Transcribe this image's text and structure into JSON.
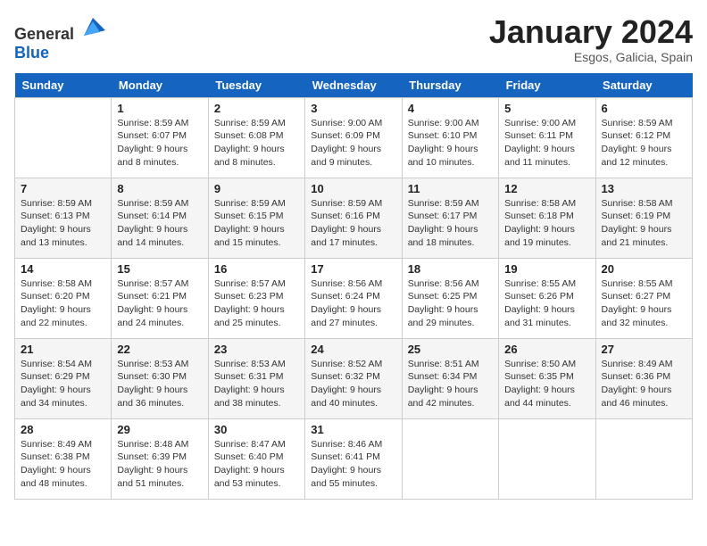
{
  "logo": {
    "text_general": "General",
    "text_blue": "Blue"
  },
  "title": "January 2024",
  "location": "Esgos, Galicia, Spain",
  "weekdays": [
    "Sunday",
    "Monday",
    "Tuesday",
    "Wednesday",
    "Thursday",
    "Friday",
    "Saturday"
  ],
  "weeks": [
    [
      {
        "day": "",
        "sunrise": "",
        "sunset": "",
        "daylight": "",
        "empty": true
      },
      {
        "day": "1",
        "sunrise": "Sunrise: 8:59 AM",
        "sunset": "Sunset: 6:07 PM",
        "daylight": "Daylight: 9 hours and 8 minutes.",
        "empty": false
      },
      {
        "day": "2",
        "sunrise": "Sunrise: 8:59 AM",
        "sunset": "Sunset: 6:08 PM",
        "daylight": "Daylight: 9 hours and 8 minutes.",
        "empty": false
      },
      {
        "day": "3",
        "sunrise": "Sunrise: 9:00 AM",
        "sunset": "Sunset: 6:09 PM",
        "daylight": "Daylight: 9 hours and 9 minutes.",
        "empty": false
      },
      {
        "day": "4",
        "sunrise": "Sunrise: 9:00 AM",
        "sunset": "Sunset: 6:10 PM",
        "daylight": "Daylight: 9 hours and 10 minutes.",
        "empty": false
      },
      {
        "day": "5",
        "sunrise": "Sunrise: 9:00 AM",
        "sunset": "Sunset: 6:11 PM",
        "daylight": "Daylight: 9 hours and 11 minutes.",
        "empty": false
      },
      {
        "day": "6",
        "sunrise": "Sunrise: 8:59 AM",
        "sunset": "Sunset: 6:12 PM",
        "daylight": "Daylight: 9 hours and 12 minutes.",
        "empty": false
      }
    ],
    [
      {
        "day": "7",
        "sunrise": "Sunrise: 8:59 AM",
        "sunset": "Sunset: 6:13 PM",
        "daylight": "Daylight: 9 hours and 13 minutes.",
        "empty": false
      },
      {
        "day": "8",
        "sunrise": "Sunrise: 8:59 AM",
        "sunset": "Sunset: 6:14 PM",
        "daylight": "Daylight: 9 hours and 14 minutes.",
        "empty": false
      },
      {
        "day": "9",
        "sunrise": "Sunrise: 8:59 AM",
        "sunset": "Sunset: 6:15 PM",
        "daylight": "Daylight: 9 hours and 15 minutes.",
        "empty": false
      },
      {
        "day": "10",
        "sunrise": "Sunrise: 8:59 AM",
        "sunset": "Sunset: 6:16 PM",
        "daylight": "Daylight: 9 hours and 17 minutes.",
        "empty": false
      },
      {
        "day": "11",
        "sunrise": "Sunrise: 8:59 AM",
        "sunset": "Sunset: 6:17 PM",
        "daylight": "Daylight: 9 hours and 18 minutes.",
        "empty": false
      },
      {
        "day": "12",
        "sunrise": "Sunrise: 8:58 AM",
        "sunset": "Sunset: 6:18 PM",
        "daylight": "Daylight: 9 hours and 19 minutes.",
        "empty": false
      },
      {
        "day": "13",
        "sunrise": "Sunrise: 8:58 AM",
        "sunset": "Sunset: 6:19 PM",
        "daylight": "Daylight: 9 hours and 21 minutes.",
        "empty": false
      }
    ],
    [
      {
        "day": "14",
        "sunrise": "Sunrise: 8:58 AM",
        "sunset": "Sunset: 6:20 PM",
        "daylight": "Daylight: 9 hours and 22 minutes.",
        "empty": false
      },
      {
        "day": "15",
        "sunrise": "Sunrise: 8:57 AM",
        "sunset": "Sunset: 6:21 PM",
        "daylight": "Daylight: 9 hours and 24 minutes.",
        "empty": false
      },
      {
        "day": "16",
        "sunrise": "Sunrise: 8:57 AM",
        "sunset": "Sunset: 6:23 PM",
        "daylight": "Daylight: 9 hours and 25 minutes.",
        "empty": false
      },
      {
        "day": "17",
        "sunrise": "Sunrise: 8:56 AM",
        "sunset": "Sunset: 6:24 PM",
        "daylight": "Daylight: 9 hours and 27 minutes.",
        "empty": false
      },
      {
        "day": "18",
        "sunrise": "Sunrise: 8:56 AM",
        "sunset": "Sunset: 6:25 PM",
        "daylight": "Daylight: 9 hours and 29 minutes.",
        "empty": false
      },
      {
        "day": "19",
        "sunrise": "Sunrise: 8:55 AM",
        "sunset": "Sunset: 6:26 PM",
        "daylight": "Daylight: 9 hours and 31 minutes.",
        "empty": false
      },
      {
        "day": "20",
        "sunrise": "Sunrise: 8:55 AM",
        "sunset": "Sunset: 6:27 PM",
        "daylight": "Daylight: 9 hours and 32 minutes.",
        "empty": false
      }
    ],
    [
      {
        "day": "21",
        "sunrise": "Sunrise: 8:54 AM",
        "sunset": "Sunset: 6:29 PM",
        "daylight": "Daylight: 9 hours and 34 minutes.",
        "empty": false
      },
      {
        "day": "22",
        "sunrise": "Sunrise: 8:53 AM",
        "sunset": "Sunset: 6:30 PM",
        "daylight": "Daylight: 9 hours and 36 minutes.",
        "empty": false
      },
      {
        "day": "23",
        "sunrise": "Sunrise: 8:53 AM",
        "sunset": "Sunset: 6:31 PM",
        "daylight": "Daylight: 9 hours and 38 minutes.",
        "empty": false
      },
      {
        "day": "24",
        "sunrise": "Sunrise: 8:52 AM",
        "sunset": "Sunset: 6:32 PM",
        "daylight": "Daylight: 9 hours and 40 minutes.",
        "empty": false
      },
      {
        "day": "25",
        "sunrise": "Sunrise: 8:51 AM",
        "sunset": "Sunset: 6:34 PM",
        "daylight": "Daylight: 9 hours and 42 minutes.",
        "empty": false
      },
      {
        "day": "26",
        "sunrise": "Sunrise: 8:50 AM",
        "sunset": "Sunset: 6:35 PM",
        "daylight": "Daylight: 9 hours and 44 minutes.",
        "empty": false
      },
      {
        "day": "27",
        "sunrise": "Sunrise: 8:49 AM",
        "sunset": "Sunset: 6:36 PM",
        "daylight": "Daylight: 9 hours and 46 minutes.",
        "empty": false
      }
    ],
    [
      {
        "day": "28",
        "sunrise": "Sunrise: 8:49 AM",
        "sunset": "Sunset: 6:38 PM",
        "daylight": "Daylight: 9 hours and 48 minutes.",
        "empty": false
      },
      {
        "day": "29",
        "sunrise": "Sunrise: 8:48 AM",
        "sunset": "Sunset: 6:39 PM",
        "daylight": "Daylight: 9 hours and 51 minutes.",
        "empty": false
      },
      {
        "day": "30",
        "sunrise": "Sunrise: 8:47 AM",
        "sunset": "Sunset: 6:40 PM",
        "daylight": "Daylight: 9 hours and 53 minutes.",
        "empty": false
      },
      {
        "day": "31",
        "sunrise": "Sunrise: 8:46 AM",
        "sunset": "Sunset: 6:41 PM",
        "daylight": "Daylight: 9 hours and 55 minutes.",
        "empty": false
      },
      {
        "day": "",
        "sunrise": "",
        "sunset": "",
        "daylight": "",
        "empty": true
      },
      {
        "day": "",
        "sunrise": "",
        "sunset": "",
        "daylight": "",
        "empty": true
      },
      {
        "day": "",
        "sunrise": "",
        "sunset": "",
        "daylight": "",
        "empty": true
      }
    ]
  ]
}
